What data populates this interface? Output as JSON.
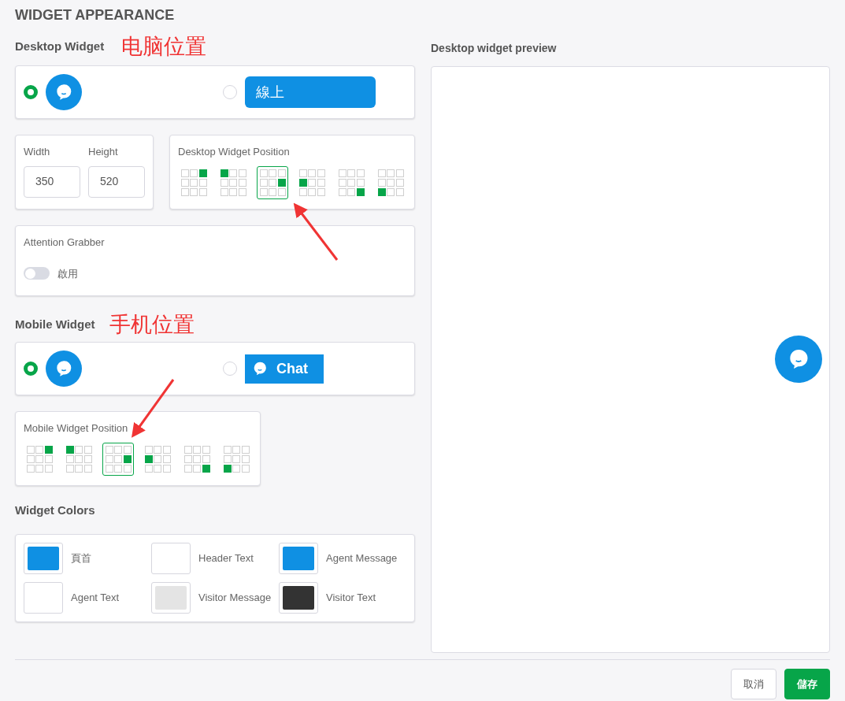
{
  "page_title": "WIDGET APPEARANCE",
  "desktop": {
    "heading": "Desktop Widget",
    "annotation": "电脑位置",
    "styles": [
      {
        "kind": "bubble",
        "selected": true
      },
      {
        "kind": "bar",
        "label": "線上",
        "selected": false
      }
    ],
    "width": {
      "label": "Width",
      "value": "350"
    },
    "height": {
      "label": "Height",
      "value": "520"
    },
    "position": {
      "label": "Desktop Widget Position",
      "options": [
        {
          "kind": "top-right",
          "selected": false
        },
        {
          "kind": "top-left",
          "selected": false
        },
        {
          "kind": "middle-right",
          "selected": true
        },
        {
          "kind": "middle-left",
          "selected": false
        },
        {
          "kind": "bottom-right",
          "selected": false
        },
        {
          "kind": "bottom-left",
          "selected": false
        }
      ]
    },
    "attention_grabber": {
      "title": "Attention Grabber",
      "toggle_label": "啟用",
      "on": false
    }
  },
  "mobile": {
    "heading": "Mobile Widget",
    "annotation": "手机位置",
    "styles": [
      {
        "kind": "bubble",
        "selected": true
      },
      {
        "kind": "tab",
        "label": "Chat",
        "selected": false
      }
    ],
    "position": {
      "label": "Mobile Widget Position",
      "options": [
        {
          "kind": "top-right",
          "selected": false
        },
        {
          "kind": "top-left",
          "selected": false
        },
        {
          "kind": "middle-right",
          "selected": true
        },
        {
          "kind": "middle-left",
          "selected": false
        },
        {
          "kind": "bottom-right",
          "selected": false
        },
        {
          "kind": "bottom-left",
          "selected": false
        }
      ]
    }
  },
  "colors": {
    "heading": "Widget Colors",
    "items": [
      {
        "label": "頁首",
        "color": "#0f90e3"
      },
      {
        "label": "Header Text",
        "color": "#ffffff"
      },
      {
        "label": "Agent Message",
        "color": "#0f90e3"
      },
      {
        "label": "Agent Text",
        "color": "#ffffff"
      },
      {
        "label": "Visitor Message",
        "color": "#e4e4e4"
      },
      {
        "label": "Visitor Text",
        "color": "#333333"
      }
    ]
  },
  "preview": {
    "heading": "Desktop widget preview"
  },
  "buttons": [
    {
      "kind": "secondary",
      "label": "取消"
    },
    {
      "kind": "primary",
      "label": "儲存"
    }
  ]
}
